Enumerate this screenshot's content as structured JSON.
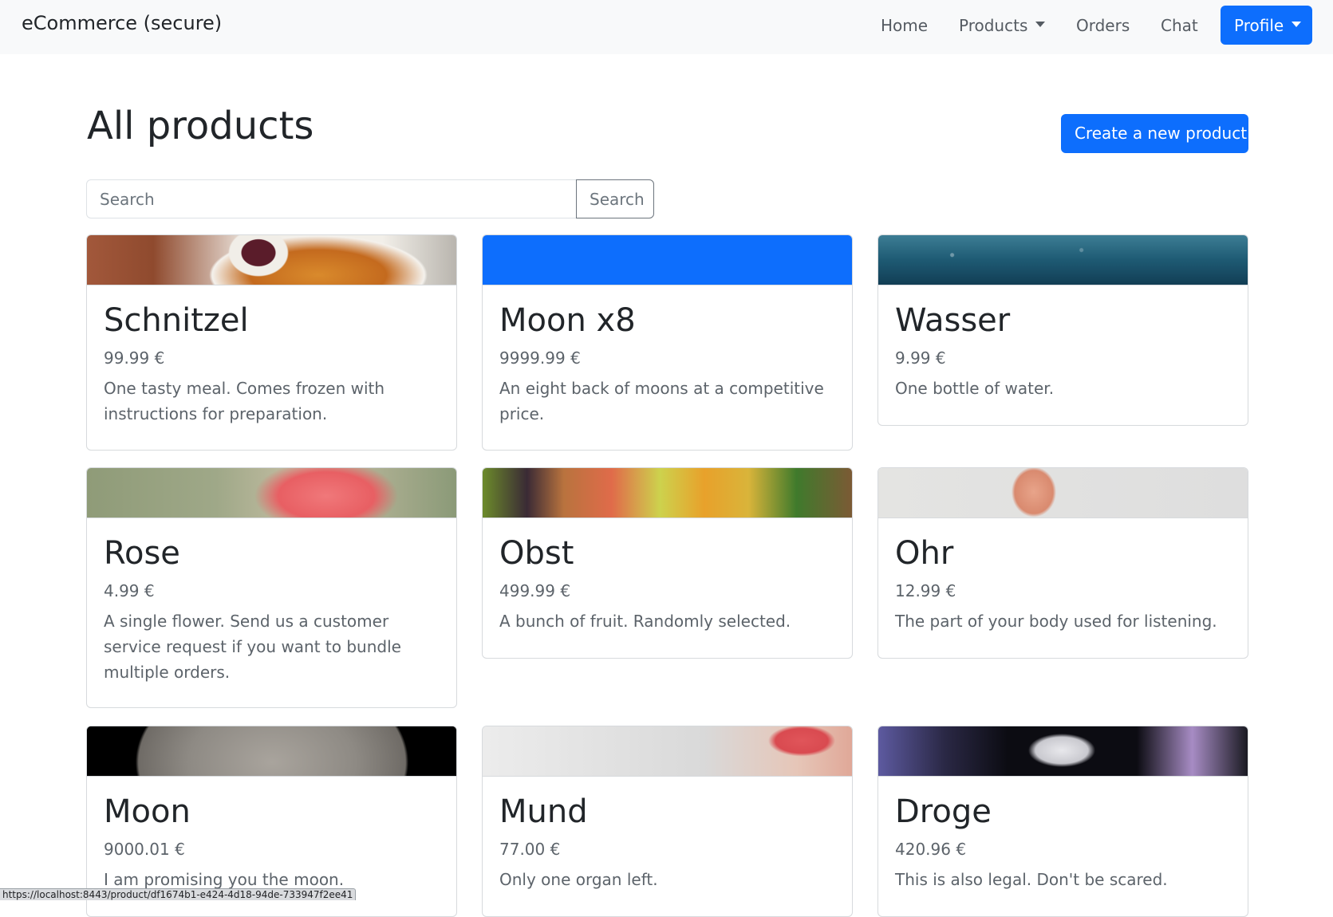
{
  "navbar": {
    "brand": "eCommerce (secure)",
    "links": {
      "home": "Home",
      "products": "Products",
      "orders": "Orders",
      "chat": "Chat"
    },
    "profile_label": "Profile",
    "bg_color": "#f8f9fa"
  },
  "accent_color": "#0d6efd",
  "main": {
    "title": "All products",
    "create_button": "Create a new product",
    "search": {
      "placeholder": "Search",
      "button_label": "Search"
    }
  },
  "products": [
    {
      "name": "Schnitzel",
      "price": "99.99 €",
      "description": "One tasty meal. Comes frozen with instructions for preparation."
    },
    {
      "name": "Moon x8",
      "price": "9999.99 €",
      "description": "An eight back of moons at a competitive price."
    },
    {
      "name": "Wasser",
      "price": "9.99 €",
      "description": "One bottle of water."
    },
    {
      "name": "Rose",
      "price": "4.99 €",
      "description": "A single flower. Send us a customer service request if you want to bundle multiple orders."
    },
    {
      "name": "Obst",
      "price": "499.99 €",
      "description": "A bunch of fruit. Randomly selected."
    },
    {
      "name": "Ohr",
      "price": "12.99 €",
      "description": "The part of your body used for listening."
    },
    {
      "name": "Moon",
      "price": "9000.01 €",
      "description": "I am promising you the moon."
    },
    {
      "name": "Mund",
      "price": "77.00 €",
      "description": "Only one organ left."
    },
    {
      "name": "Droge",
      "price": "420.96 €",
      "description": "This is also legal. Don't be scared."
    }
  ],
  "status_bar_url": "https://localhost:8443/product/df1674b1-e424-4d18-94de-733947f2ee41"
}
